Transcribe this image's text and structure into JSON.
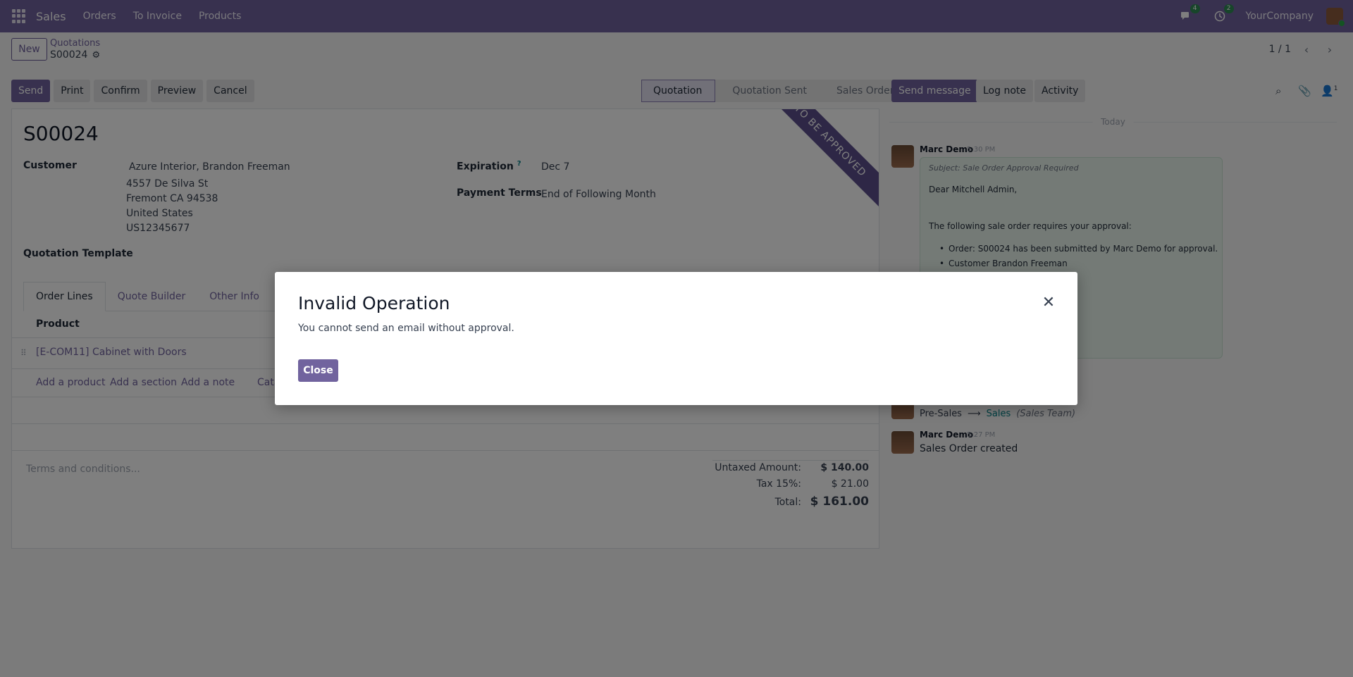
{
  "navbar": {
    "app_name": "Sales",
    "menu": [
      "Orders",
      "To Invoice",
      "Products"
    ],
    "messages_badge": "4",
    "activities_badge": "2",
    "company": "YourCompany"
  },
  "control_panel": {
    "new_label": "New",
    "breadcrumb_parent": "Quotations",
    "breadcrumb_current": "S00024",
    "pager": "1 / 1"
  },
  "actions": {
    "send": "Send",
    "print": "Print",
    "confirm": "Confirm",
    "preview": "Preview",
    "cancel": "Cancel"
  },
  "status": {
    "steps": [
      "Quotation",
      "Quotation Sent",
      "Sales Order"
    ],
    "active": "Quotation"
  },
  "form": {
    "ribbon": "TO BE APPROVED",
    "title": "S00024",
    "customer_label": "Customer",
    "customer_name": "Azure Interior, Brandon Freeman",
    "address_lines": [
      "4557 De Silva St",
      "Fremont CA 94538",
      "United States",
      "US12345677"
    ],
    "expiration_label": "Expiration",
    "expiration_help": "?",
    "expiration_value": "Dec 7",
    "payment_terms_label": "Payment Terms",
    "payment_terms_value": "End of Following Month",
    "template_label": "Quotation Template",
    "tabs": [
      "Order Lines",
      "Quote Builder",
      "Other Info"
    ],
    "product_header": "Product",
    "lines": [
      {
        "product": "[E-COM11] Cabinet with Doors"
      }
    ],
    "add_links": [
      "Add a product",
      "Add a section",
      "Add a note",
      "Cata"
    ],
    "terms_placeholder": "Terms and conditions...",
    "totals": {
      "untaxed_label": "Untaxed Amount:",
      "untaxed_value": "$ 140.00",
      "tax_label": "Tax 15%:",
      "tax_value": "$ 21.00",
      "total_label": "Total:",
      "total_value": "$ 161.00"
    }
  },
  "chatter": {
    "send_message": "Send message",
    "log_note": "Log note",
    "activity": "Activity",
    "followers_count": "1",
    "today": "Today",
    "messages": [
      {
        "author": "Marc Demo",
        "time": "5:30 PM",
        "subject": "Subject: Sale Order Approval Required",
        "greeting": "Dear Mitchell Admin,",
        "intro": "The following sale order requires your approval:",
        "bullets": [
          "Order: S00024 has been submitted by Marc Demo for approval.",
          "Customer Brandon Freeman"
        ]
      },
      {
        "tracking_from": "Pre-Sales",
        "tracking_to": "Sales",
        "tracking_field": "(Sales Team)"
      },
      {
        "author": "Marc Demo",
        "time": "5:27 PM",
        "body": "Sales Order created"
      }
    ]
  },
  "modal": {
    "title": "Invalid Operation",
    "body": "You cannot send an email without approval.",
    "close_label": "Close"
  }
}
